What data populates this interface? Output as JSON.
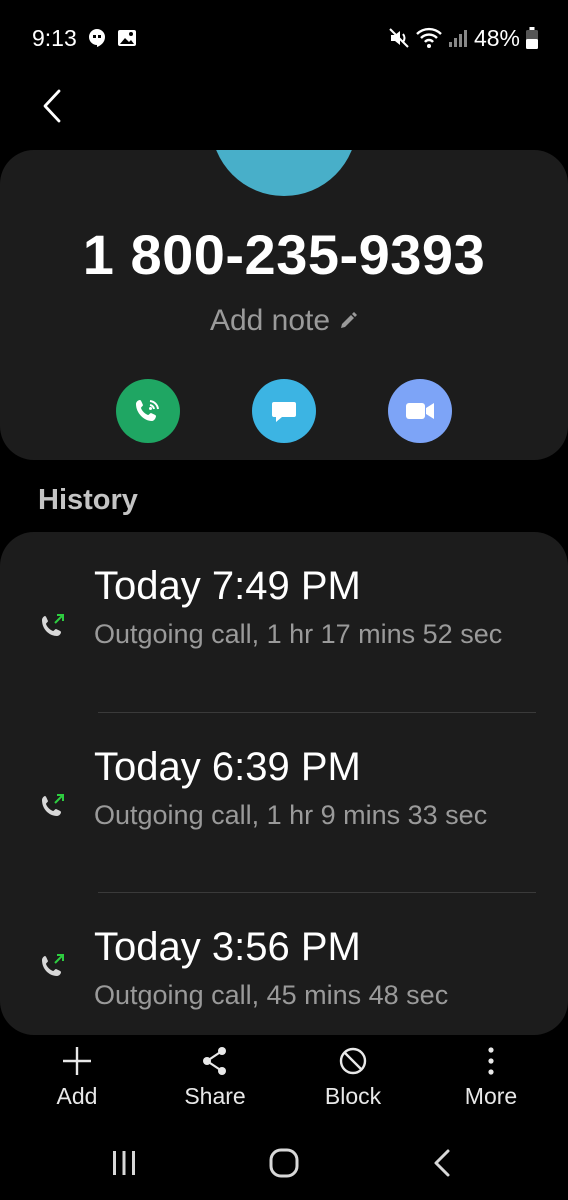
{
  "status_bar": {
    "time": "9:13",
    "battery": "48%",
    "icons": [
      "hangouts-icon",
      "image-icon",
      "mute-icon",
      "wifi-icon",
      "signal-icon",
      "battery-icon"
    ]
  },
  "contact": {
    "number": "1 800-235-9393",
    "add_note": "Add note",
    "avatar_color": "#48afc9",
    "actions": [
      {
        "name": "wifi-call-button",
        "icon": "wifi-call-icon",
        "color": "#1fa663"
      },
      {
        "name": "message-button",
        "icon": "message-icon",
        "color": "#3cb4e3"
      },
      {
        "name": "video-call-button",
        "icon": "video-call-icon",
        "color": "#7da4f7"
      }
    ]
  },
  "history": {
    "heading": "History",
    "calls": [
      {
        "time": "Today 7:49 PM",
        "detail": "Outgoing call, 1 hr 17 mins 52 sec",
        "type": "outgoing-call-icon"
      },
      {
        "time": "Today 6:39 PM",
        "detail": "Outgoing call, 1 hr 9 mins 33 sec",
        "type": "outgoing-call-icon"
      },
      {
        "time": "Today 3:56 PM",
        "detail": "Outgoing call, 45 mins 48 sec",
        "type": "outgoing-call-icon"
      }
    ]
  },
  "bottom_bar": {
    "add": "Add",
    "share": "Share",
    "block": "Block",
    "more": "More"
  },
  "colors": {
    "background": "#000000",
    "card": "#1c1c1c",
    "secondary_text": "#9a9a9a",
    "outgoing_arrow": "#2ecc40"
  }
}
